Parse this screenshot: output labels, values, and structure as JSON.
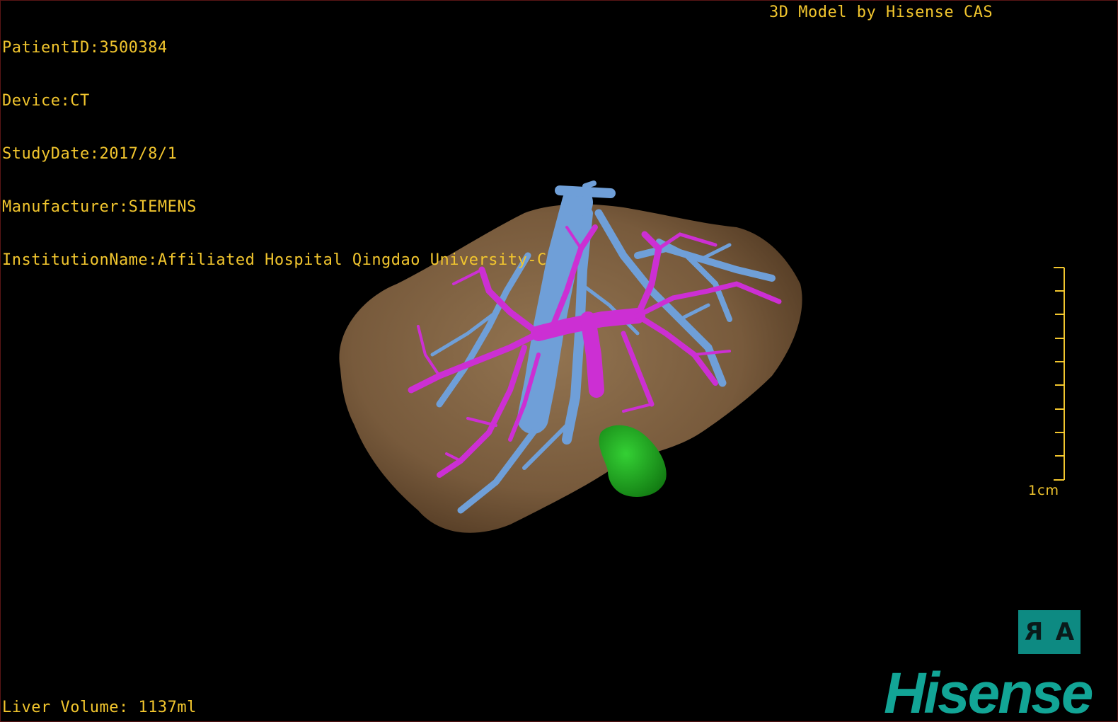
{
  "header": {
    "patient_id": "PatientID:3500384",
    "device": "Device:CT",
    "study_date": "StudyDate:2017/8/1",
    "manufacturer": "Manufacturer:SIEMENS",
    "institution": "InstitutionName:Affiliated Hospital Qingdao University-C"
  },
  "credit": "3D Model by Hisense CAS",
  "scale_bar": {
    "label": "1cm"
  },
  "footer": {
    "liver_volume": "Liver Volume: 1137ml"
  },
  "orientation_badge": {
    "left": "R",
    "right": "A"
  },
  "brand": {
    "name": "Hisense"
  },
  "colors": {
    "overlay_text": "#f2c62e",
    "liver": "#8a6a45",
    "hepatic_vein": "#6f9fd8",
    "portal_vein": "#cc2fd3",
    "lesion": "#1aa51a",
    "brand": "#12a596"
  }
}
